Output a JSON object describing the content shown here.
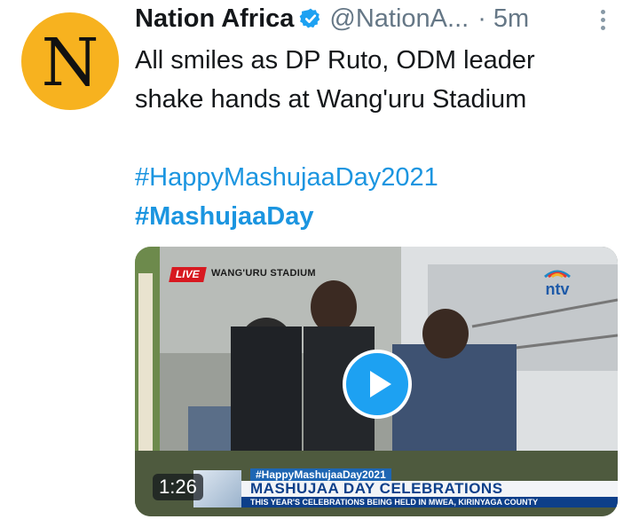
{
  "tweet": {
    "avatar_letter": "N",
    "avatar_color": "#f7b21f",
    "display_name": "Nation Africa",
    "verified_icon": "verified-badge-icon",
    "handle": "@NationA...",
    "separator": "·",
    "time": "5m",
    "more_icon": "more-vertical-icon",
    "text_lines": [
      "All smiles as DP Ruto, ODM leader",
      "shake hands at Wang'uru Stadium"
    ],
    "hashtags": [
      "#HappyMashujaaDay2021",
      "#MashujaaDay"
    ],
    "link_color": "#1b95e0"
  },
  "video": {
    "live_label": "LIVE",
    "location": "WANG'URU STADIUM",
    "channel_logo": "ntv",
    "lower_third_hashtag": "#HappyMashujaaDay2021",
    "lower_third_title": "MASHUJAA DAY CELEBRATIONS",
    "lower_third_subtitle": "THIS YEAR'S CELEBRATIONS BEING HELD IN MWEA, KIRINYAGA COUNTY",
    "duration": "1:26",
    "play_icon": "play-icon",
    "accent_color": "#1da1f2"
  }
}
